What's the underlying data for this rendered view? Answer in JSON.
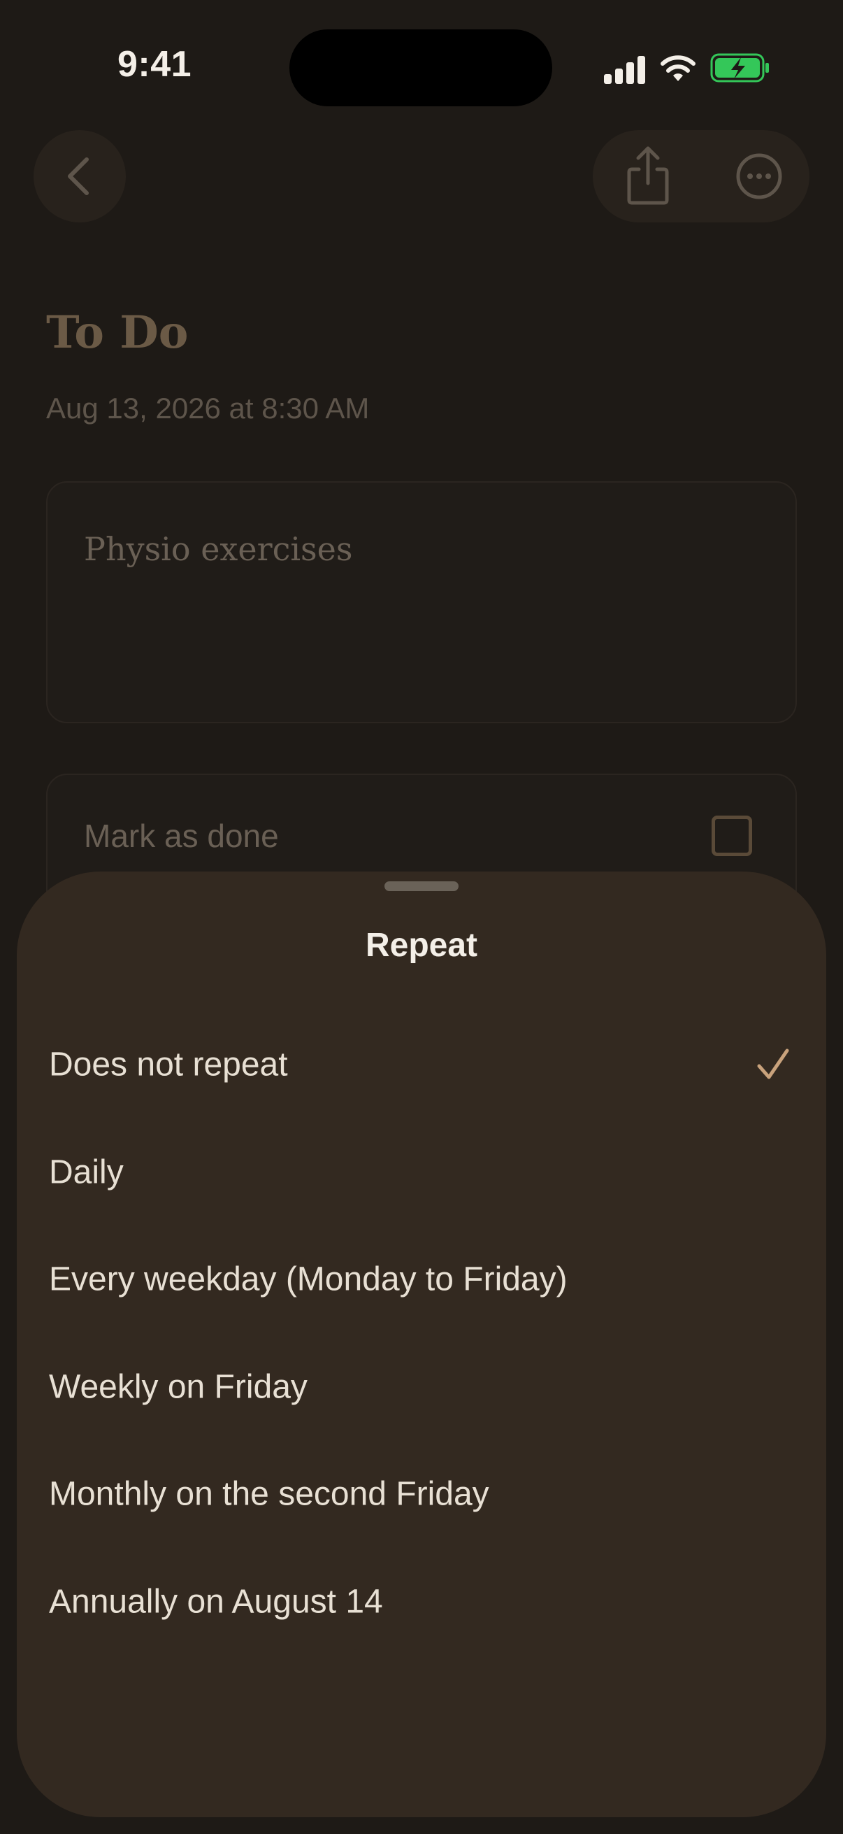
{
  "status_bar": {
    "time": "9:41"
  },
  "nav": {
    "back_icon": "chevron-left-icon",
    "share_icon": "share-icon",
    "more_icon": "ellipsis-circle-icon"
  },
  "note": {
    "title": "To Do",
    "date": "Aug 13, 2026 at 8:30 AM",
    "body": "Physio exercises",
    "mark_done_label": "Mark as done"
  },
  "sheet": {
    "title": "Repeat",
    "options": [
      {
        "label": "Does not repeat",
        "selected": true
      },
      {
        "label": "Daily",
        "selected": false
      },
      {
        "label": "Every weekday (Monday to Friday)",
        "selected": false
      },
      {
        "label": "Weekly on Friday",
        "selected": false
      },
      {
        "label": "Monthly on the second Friday",
        "selected": false
      },
      {
        "label": "Annually on August 14",
        "selected": false
      }
    ]
  },
  "colors": {
    "background": "#1e1a16",
    "sheet": "#332920",
    "accent": "#c9a27c",
    "battery_green": "#34c759"
  }
}
